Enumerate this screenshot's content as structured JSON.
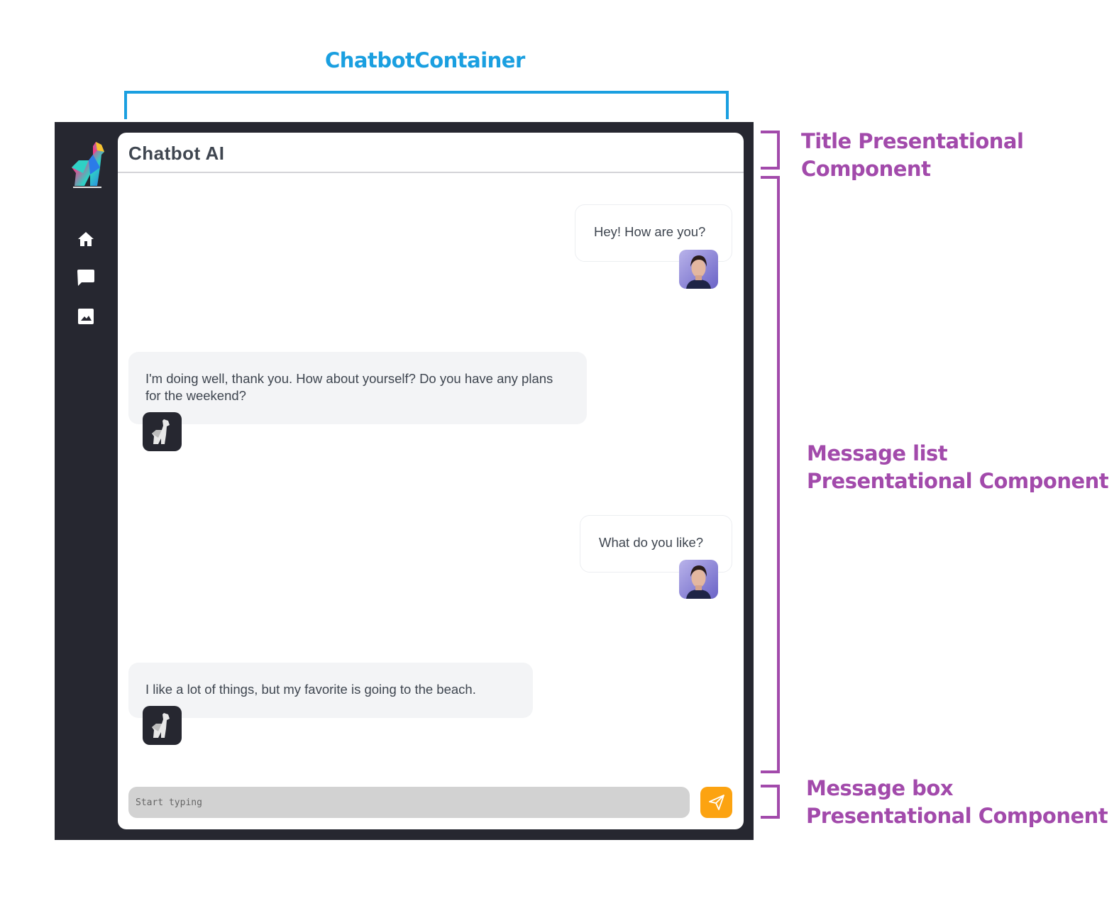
{
  "annotations": {
    "container_label": "ChatbotContainer",
    "title_component": [
      "Title Presentational",
      "Component"
    ],
    "message_list_component": [
      "Message list",
      "Presentational Component"
    ],
    "message_box_component": [
      "Message box",
      "Presentational Component"
    ]
  },
  "app": {
    "title": "Chatbot AI",
    "sidebar": {
      "logo_icon": "llama-logo-icon",
      "items": [
        {
          "icon": "home-icon"
        },
        {
          "icon": "chat-bubble-icon"
        },
        {
          "icon": "image-icon"
        }
      ]
    },
    "messages": [
      {
        "sender": "user",
        "text": "Hey! How are you?"
      },
      {
        "sender": "bot",
        "text": "I'm doing well, thank you. How about yourself? Do you have any plans for the weekend?"
      },
      {
        "sender": "user",
        "text": "What do you like?"
      },
      {
        "sender": "bot",
        "text": "I like a lot of things, but my favorite is going to the beach."
      }
    ],
    "composer": {
      "placeholder": "Start typing",
      "send_icon": "send-icon"
    }
  },
  "colors": {
    "annotation_blue": "#1a9fe0",
    "annotation_purple": "#a24aab",
    "frame_dark": "#262730",
    "send_button": "#fca311",
    "bot_bubble": "#f3f4f6"
  }
}
